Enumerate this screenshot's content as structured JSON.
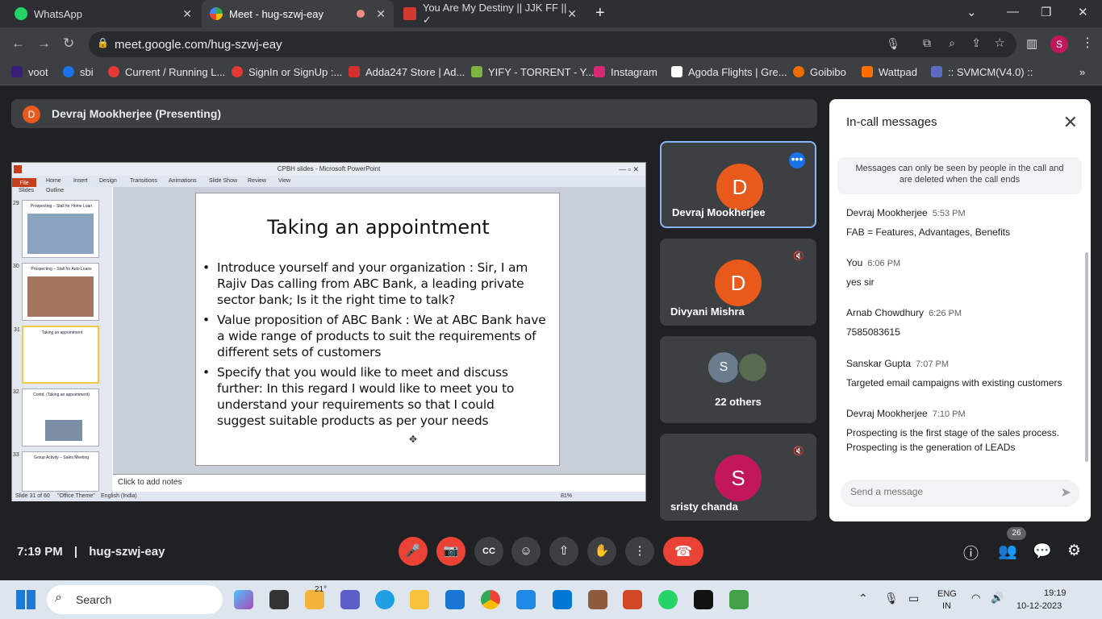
{
  "browser": {
    "tabs": [
      {
        "label": "WhatsApp"
      },
      {
        "label": "Meet - hug-szwj-eay"
      },
      {
        "label": "You Are My Destiny || JJK FF || ✓"
      }
    ],
    "url": "meet.google.com/hug-szwj-eay",
    "profile_initial": "S",
    "bookmarks": [
      {
        "label": "voot"
      },
      {
        "label": "sbi"
      },
      {
        "label": "Current / Running L..."
      },
      {
        "label": "SignIn or SignUp :..."
      },
      {
        "label": "Adda247 Store | Ad..."
      },
      {
        "label": "YIFY - TORRENT - Y..."
      },
      {
        "label": "Instagram"
      },
      {
        "label": "Agoda Flights | Gre..."
      },
      {
        "label": "Goibibo"
      },
      {
        "label": "Wattpad"
      },
      {
        "label": ":: SVMCM(V4.0) ::"
      }
    ]
  },
  "meet": {
    "presenter_initial": "D",
    "presenter_label": "Devraj Mookherjee (Presenting)",
    "meeting_code": "hug-szwj-eay",
    "time": "7:19 PM",
    "divider": "|",
    "participants_count": "26",
    "tiles": [
      {
        "name": "Devraj Mookherjee",
        "initial": "D",
        "color": "#e8591c"
      },
      {
        "name": "Divyani Mishra",
        "initial": "D",
        "color": "#e8591c"
      },
      {
        "name": "22 others",
        "initial": "S",
        "color": "#6b7d8c"
      },
      {
        "name": "sristy chanda",
        "initial": "S",
        "color": "#c2185b"
      }
    ]
  },
  "ppt": {
    "window_title": "CPBH slides  -  Microsoft PowerPoint",
    "ribbon": [
      "File",
      "Home",
      "Insert",
      "Design",
      "Transitions",
      "Animations",
      "Slide Show",
      "Review",
      "View"
    ],
    "panel_tabs": [
      "Slides",
      "Outline"
    ],
    "thumbs": [
      {
        "num": "29",
        "title": "Prospecting – Stall for Home Loan"
      },
      {
        "num": "30",
        "title": "Prospecting – Stall for Auto Loans"
      },
      {
        "num": "31",
        "title": "Taking an appointment"
      },
      {
        "num": "32",
        "title": "Contd. (Taking an appointment)"
      },
      {
        "num": "33",
        "title": "Group Activity – Sales Meeting"
      }
    ],
    "slide": {
      "title": "Taking an appointment",
      "bullets": [
        "Introduce yourself and your organization :     Sir, I am Rajiv Das calling from ABC Bank, a leading private sector bank;  Is it the right time to talk?",
        "Value proposition of ABC Bank : We at ABC Bank have a wide range of products to suit the requirements of different sets of customers",
        "Specify that you would like to meet and discuss further: In this regard I would like to meet you to understand your requirements so that I could suggest suitable products as per your needs"
      ]
    },
    "notes": "Click to add notes",
    "status_slide": "Slide 31 of 60",
    "status_theme": "\"Office Theme\"",
    "status_lang": "English (India)",
    "zoom": "81%"
  },
  "chat": {
    "title": "In-call messages",
    "notice": "Messages can only be seen by people in the call and are deleted when the call ends",
    "messages": [
      {
        "sender": "Devraj Mookherjee",
        "time": "5:53 PM",
        "text": "FAB = Features, Advantages, Benefits"
      },
      {
        "sender": "You",
        "time": "6:06 PM",
        "text": "yes sir"
      },
      {
        "sender": "Arnab Chowdhury",
        "time": "6:26 PM",
        "text": "7585083615"
      },
      {
        "sender": "Sanskar Gupta",
        "time": "7:07 PM",
        "text": "Targeted email campaigns with existing customers"
      },
      {
        "sender": "Devraj Mookherjee",
        "time": "7:10 PM",
        "text": "Prospecting is the first stage of the sales process. Prospecting is the generation of LEADs"
      }
    ],
    "placeholder": "Send a message"
  },
  "taskbar": {
    "search": "Search",
    "weather": "21°",
    "lang1": "ENG",
    "lang2": "IN",
    "clock_time": "19:19",
    "clock_date": "10-12-2023"
  }
}
